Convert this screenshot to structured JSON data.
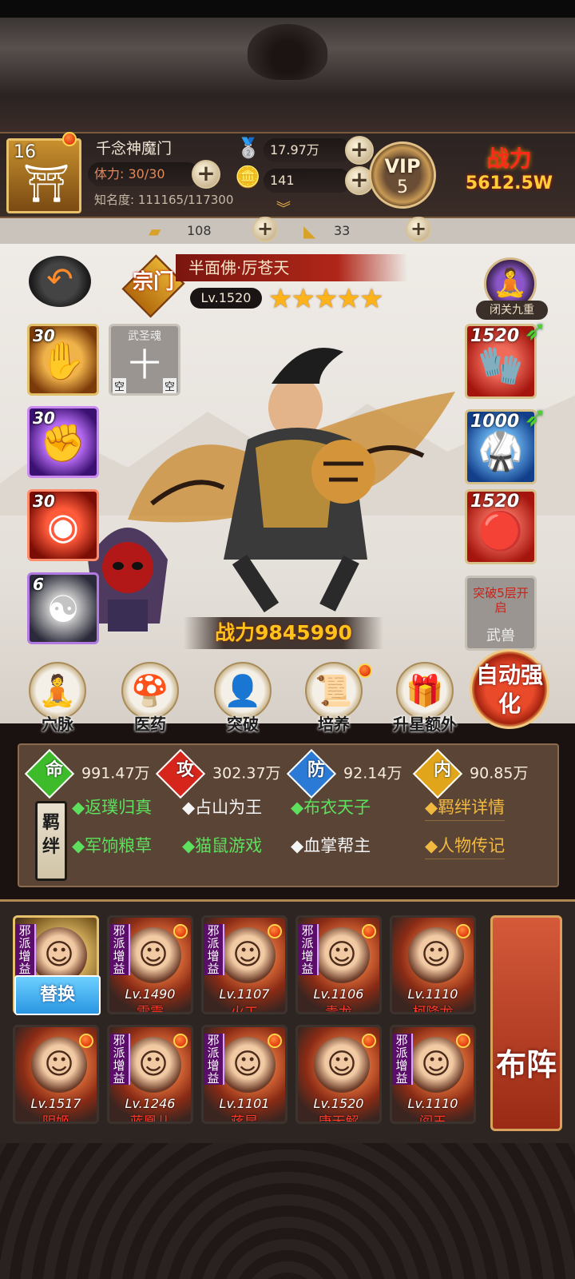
{
  "player": {
    "level": "16",
    "name": "千念神魔门",
    "stamina_label": "体力: 30/30",
    "fame_label": "知名度: 111165/117300",
    "silver": "17.97万",
    "gold": "141",
    "vip_label": "VIP",
    "vip_level": "5",
    "power_label": "战力",
    "power_value": "5612.5W"
  },
  "resources": {
    "ingot": "108",
    "ticket": "33"
  },
  "hero": {
    "sect_tag": "宗门",
    "name": "半面佛·厉苍天",
    "level": "Lv.1520",
    "stars": 5,
    "meditation_label": "闭关九重",
    "power_text": "战力9845990"
  },
  "skill_slots": [
    {
      "level": "30",
      "icon": "palm-icon"
    },
    {
      "level": "",
      "icon": "saint-soul-icon",
      "title": "武圣魂",
      "glyph": "十",
      "empty_a": "空",
      "empty_b": "空"
    },
    {
      "level": "30",
      "icon": "fist-icon"
    },
    {
      "level": "30",
      "icon": "red-orb-icon"
    },
    {
      "level": "6",
      "icon": "yinyang-icon"
    }
  ],
  "equipment": [
    {
      "level": "1520",
      "icon": "gauntlet-icon"
    },
    {
      "level": "1000",
      "icon": "robe-icon"
    },
    {
      "level": "1520",
      "icon": "amulet-icon"
    },
    {
      "label": "突破5层开启",
      "sub": "武兽"
    }
  ],
  "functions": [
    {
      "label": "穴脉",
      "icon": "meridian-icon"
    },
    {
      "label": "医药",
      "icon": "mushroom-icon"
    },
    {
      "label": "突破",
      "icon": "breakthrough-icon"
    },
    {
      "label": "培养",
      "icon": "scroll-icon"
    },
    {
      "label": "升星额外",
      "icon": "treasure-icon"
    }
  ],
  "auto_enhance": "自动强化",
  "stats": [
    {
      "key": "命",
      "value": "991.47万",
      "color": "#3dbb2a"
    },
    {
      "key": "攻",
      "value": "302.37万",
      "color": "#d6261c"
    },
    {
      "key": "防",
      "value": "92.14万",
      "color": "#2a7ad6"
    },
    {
      "key": "内",
      "value": "90.85万",
      "color": "#e0a51a"
    }
  ],
  "bond_label": "羁绊",
  "traits": [
    {
      "text": "◆返璞归真",
      "active": true
    },
    {
      "text": "◆占山为王",
      "active": false
    },
    {
      "text": "◆布衣天子",
      "active": true
    },
    {
      "text": "◆军饷粮草",
      "active": true
    },
    {
      "text": "◆猫鼠游戏",
      "active": true
    },
    {
      "text": "◆血掌帮主",
      "active": false
    }
  ],
  "links": {
    "bond_detail": "◆羁绊详情",
    "biography": "◆人物传记"
  },
  "team": {
    "swap_label": "替换",
    "tag": "邪派增益",
    "members": [
      {
        "level": "Lv.1490",
        "name": "雷震"
      },
      {
        "level": "Lv.1107",
        "name": "火工"
      },
      {
        "level": "Lv.1106",
        "name": "青龙"
      },
      {
        "level": "Lv.1110",
        "name": "柯降龙"
      },
      {
        "level": "Lv.1517",
        "name": "阴姬"
      },
      {
        "level": "Lv.1246",
        "name": "蓝凰儿"
      },
      {
        "level": "Lv.1101",
        "name": "蒋昆"
      },
      {
        "level": "Lv.1520",
        "name": "唐无解"
      },
      {
        "level": "Lv.1110",
        "name": "阎王"
      }
    ],
    "formation_label": "布阵"
  }
}
